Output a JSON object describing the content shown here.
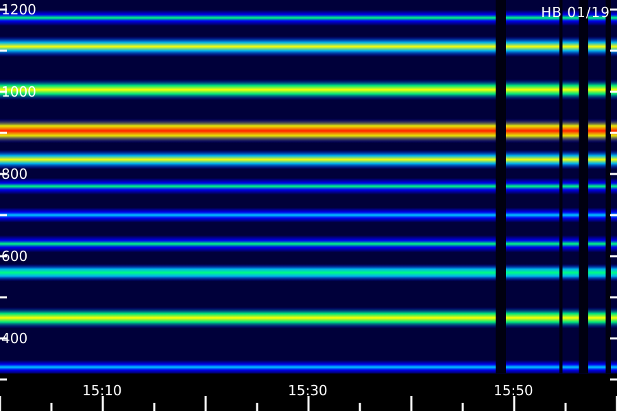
{
  "chart_data": {
    "type": "heatmap",
    "annotation": "HB 01/19",
    "ylabel": "",
    "xlabel": "",
    "y_tick_labels": [
      "1200",
      "1000",
      "800",
      "600",
      "400"
    ],
    "x_tick_labels": [
      "15:10",
      "15:30",
      "15:50"
    ],
    "ylim": [
      250,
      1200
    ],
    "x_time_range": [
      "15:00",
      "15:60"
    ],
    "grid": false,
    "colormap": [
      "#00005a",
      "#0000ff",
      "#00c8ff",
      "#00ff80",
      "#ffff00",
      "#ff2000"
    ],
    "bands": [
      {
        "y": 1180,
        "level": 0.52
      },
      {
        "y": 1110,
        "level": 0.78
      },
      {
        "y": 1005,
        "level": 0.8
      },
      {
        "y": 905,
        "level": 1.0
      },
      {
        "y": 835,
        "level": 0.72
      },
      {
        "y": 770,
        "level": 0.55
      },
      {
        "y": 700,
        "level": 0.45
      },
      {
        "y": 630,
        "level": 0.58
      },
      {
        "y": 560,
        "level": 0.6
      },
      {
        "y": 450,
        "level": 0.82
      },
      {
        "y": 330,
        "level": 0.42
      }
    ],
    "gaps_minutes": [
      [
        48.2,
        49.2
      ],
      [
        54.4,
        54.7
      ],
      [
        56.3,
        57.2
      ],
      [
        58.9,
        59.4
      ]
    ]
  }
}
